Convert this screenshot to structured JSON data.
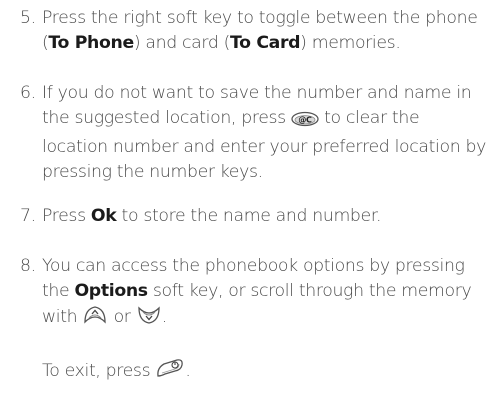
{
  "steps": [
    {
      "number": "5.",
      "text_1": "Press the right soft key to toggle between the phone (",
      "bold_1": "To Phone",
      "text_2": ") and card (",
      "bold_2": "To Card",
      "text_3": ") memories."
    },
    {
      "number": "6.",
      "text_1": "If you do not want to save the number and name in the suggested location, press",
      "icon_1": "clear-key-icon",
      "text_2": "to clear the location number and enter your preferred location by pressing the number keys."
    },
    {
      "number": "7.",
      "text_1": "Press",
      "bold_1": "Ok",
      "text_2": "to store the name and number."
    },
    {
      "number": "8.",
      "text_1": "You can access the phonebook options by pressing the",
      "bold_1": "Options",
      "text_2": "soft key, or scroll through the memory with",
      "icon_1": "scroll-up-key-icon",
      "text_3": "or",
      "icon_2": "scroll-down-key-icon",
      "text_4": "."
    }
  ],
  "exit": {
    "text": "To exit, press",
    "icon": "end-key-icon",
    "end": "."
  }
}
